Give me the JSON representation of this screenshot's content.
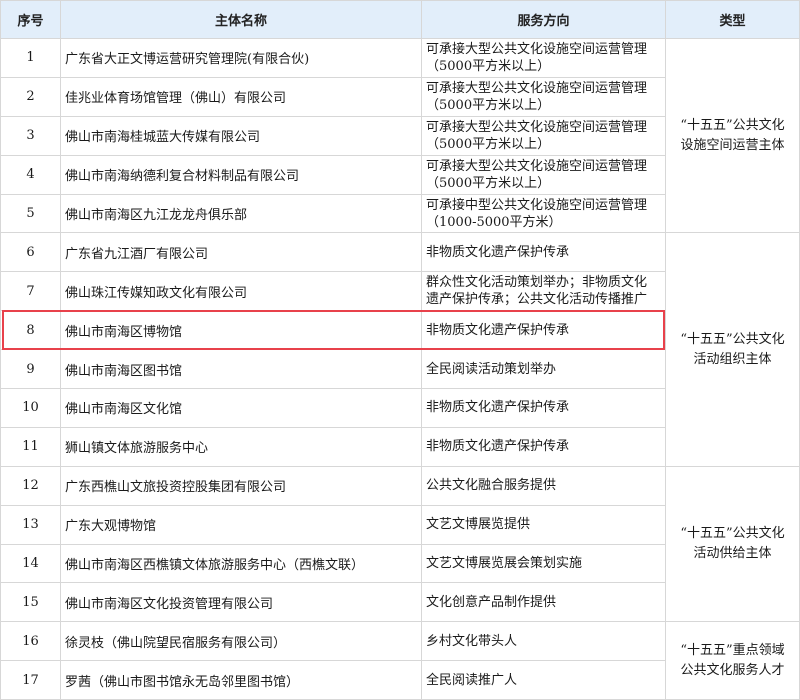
{
  "header": {
    "no": "序号",
    "name": "主体名称",
    "direction": "服务方向",
    "type": "类型"
  },
  "rows": [
    {
      "no": "1",
      "name": "广东省大正文博运营研究管理院(有限合伙)",
      "dir1": "可承接大型公共文化设施空间运营管理",
      "dir2": "（5000平方米以上）"
    },
    {
      "no": "2",
      "name": "佳兆业体育场馆管理（佛山）有限公司",
      "dir1": "可承接大型公共文化设施空间运营管理",
      "dir2": "（5000平方米以上）"
    },
    {
      "no": "3",
      "name": "佛山市南海桂城蓝大传媒有限公司",
      "dir1": "可承接大型公共文化设施空间运营管理",
      "dir2": "（5000平方米以上）"
    },
    {
      "no": "4",
      "name": "佛山市南海纳德利复合材料制品有限公司",
      "dir1": "可承接大型公共文化设施空间运营管理",
      "dir2": "（5000平方米以上）"
    },
    {
      "no": "5",
      "name": "佛山市南海区九江龙龙舟俱乐部",
      "dir1": "可承接中型公共文化设施空间运营管理",
      "dir2": "（1000-5000平方米）"
    },
    {
      "no": "6",
      "name": "广东省九江酒厂有限公司",
      "dir1": "非物质文化遗产保护传承",
      "dir2": ""
    },
    {
      "no": "7",
      "name": "佛山珠江传媒知政文化有限公司",
      "dir1": "群众性文化活动策划举办；非物质文化",
      "dir2": "遗产保护传承；公共文化活动传播推广"
    },
    {
      "no": "8",
      "name": "佛山市南海区博物馆",
      "dir1": "非物质文化遗产保护传承",
      "dir2": ""
    },
    {
      "no": "9",
      "name": "佛山市南海区图书馆",
      "dir1": "全民阅读活动策划举办",
      "dir2": ""
    },
    {
      "no": "10",
      "name": "佛山市南海区文化馆",
      "dir1": "非物质文化遗产保护传承",
      "dir2": ""
    },
    {
      "no": "11",
      "name": "狮山镇文体旅游服务中心",
      "dir1": "非物质文化遗产保护传承",
      "dir2": ""
    },
    {
      "no": "12",
      "name": "广东西樵山文旅投资控股集团有限公司",
      "dir1": "公共文化融合服务提供",
      "dir2": ""
    },
    {
      "no": "13",
      "name": "广东大观博物馆",
      "dir1": "文艺文博展览提供",
      "dir2": ""
    },
    {
      "no": "14",
      "name": "佛山市南海区西樵镇文体旅游服务中心（西樵文联）",
      "dir1": "文艺文博展览展会策划实施",
      "dir2": ""
    },
    {
      "no": "15",
      "name": "佛山市南海区文化投资管理有限公司",
      "dir1": "文化创意产品制作提供",
      "dir2": ""
    },
    {
      "no": "16",
      "name": "徐灵枝（佛山院望民宿服务有限公司）",
      "dir1": "乡村文化带头人",
      "dir2": ""
    },
    {
      "no": "17",
      "name": "罗茜（佛山市图书馆永无岛邻里图书馆）",
      "dir1": "全民阅读推广人",
      "dir2": ""
    }
  ],
  "types": [
    {
      "line1": "“十五五”公共文化",
      "line2": "设施空间运营主体"
    },
    {
      "line1": "“十五五”公共文化",
      "line2": "活动组织主体"
    },
    {
      "line1": "“十五五”公共文化",
      "line2": "活动供给主体"
    },
    {
      "line1": "“十五五”重点领域",
      "line2": "公共文化服务人才"
    }
  ],
  "colors": {
    "header_bg": "#e2eefa",
    "highlight": "#e8414b",
    "border": "#d7d7d7"
  }
}
